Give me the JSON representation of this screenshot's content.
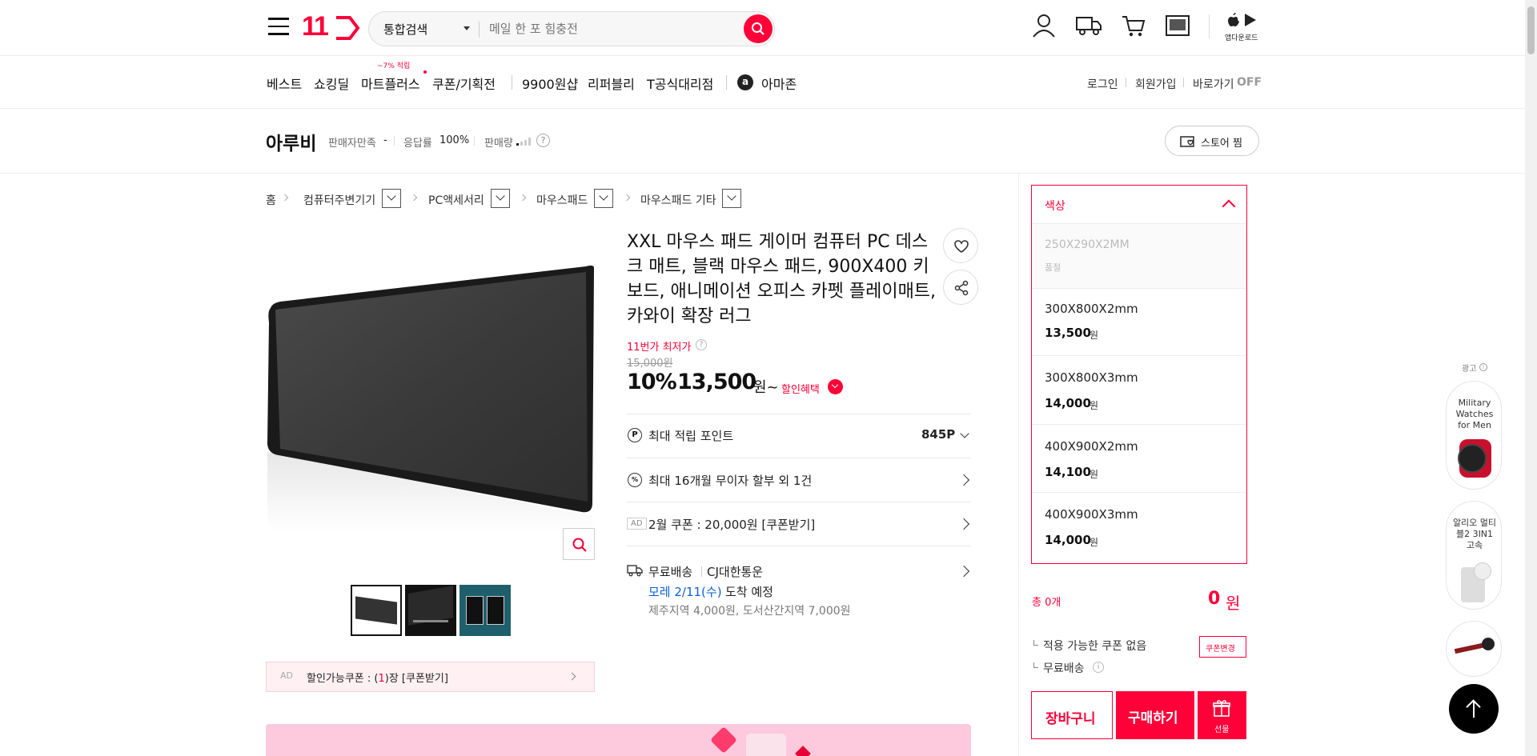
{
  "header": {
    "logo": "11",
    "search": {
      "category": "통합검색",
      "placeholder": "메일 한 포 힘충전"
    },
    "app_download": "앱다운로드"
  },
  "gnb": {
    "items": [
      "베스트",
      "쇼킹딜",
      "마트플러스",
      "쿠폰/기획전",
      "9900원샵",
      "리퍼블리",
      "T공식대리점",
      "아마존"
    ],
    "mart_badge": "~7% 적립",
    "right": {
      "login": "로그인",
      "signup": "회원가입",
      "shortcut": "바로가기",
      "shortcut_state": "OFF"
    }
  },
  "store": {
    "name": "아루비",
    "satisfaction_label": "판매자만족",
    "satisfaction_value": "-",
    "response_label": "응답률",
    "response_value": "100%",
    "sales_label": "판매량",
    "follow_label": "스토어 찜"
  },
  "breadcrumb": {
    "home": "홈",
    "items": [
      "컴퓨터주변기기",
      "PC액세서리",
      "마우스패드",
      "마우스패드 기타"
    ]
  },
  "product": {
    "title": "XXL 마우스 패드 게이머 컴퓨터 PC 데스크 매트, 블랙 마우스 패드, 900X400 키보드, 애니메이션 오피스 카펫 플레이매트, 카와이 확장 러그",
    "lowest_label": "11번가 최저가",
    "original_price": "15,000원",
    "discount": "10%",
    "price": "13,500",
    "price_unit": "원~",
    "benefit_label": "할인혜택",
    "points_label": "최대 적립 포인트",
    "points_value": "845P",
    "installment_label": "최대 16개월 무이자 할부 외 1건",
    "coupon_ad_tag": "AD",
    "coupon_label": "2월 쿠폰 : 20,000원 [쿠폰받기]",
    "shipping_label": "무료배송",
    "shipping_carrier": "CJ대한통운",
    "arrival_date": "모레 2/11(수)",
    "arrival_suffix": "도착 예정",
    "shipping_extra": "제주지역 4,000원, 도서산간지역 7,000원",
    "discount_coupon_ad": "AD",
    "discount_coupon_prefix": "할인가능쿠폰 : (",
    "discount_coupon_count": "1",
    "discount_coupon_suffix": ")장 [쿠폰받기]"
  },
  "options": {
    "title": "색상",
    "items": [
      {
        "name": "250X290X2MM",
        "price": "",
        "status": "품절"
      },
      {
        "name": "300X800X2mm",
        "price": "13,500",
        "status": ""
      },
      {
        "name": "300X800X3mm",
        "price": "14,000",
        "status": ""
      },
      {
        "name": "400X900X2mm",
        "price": "14,100",
        "status": ""
      },
      {
        "name": "400X900X3mm",
        "price": "14,000",
        "status": ""
      }
    ],
    "won": "원",
    "total_label": "총 0개",
    "total_value": "0",
    "total_unit": "원",
    "no_coupon": "적용 가능한 쿠폰 없음",
    "coupon_change": "쿠폰변경",
    "free_ship": "무료배송",
    "cart_btn": "장바구니",
    "buy_btn": "구매하기",
    "gift_btn": "선물"
  },
  "ads": {
    "label": "광고",
    "card1": "Military Watches for Men",
    "card2": "알리오 멀티블2 3IN1 고속"
  },
  "colors": {
    "brand": "#ff0038",
    "link_blue": "#0b5ed7"
  }
}
